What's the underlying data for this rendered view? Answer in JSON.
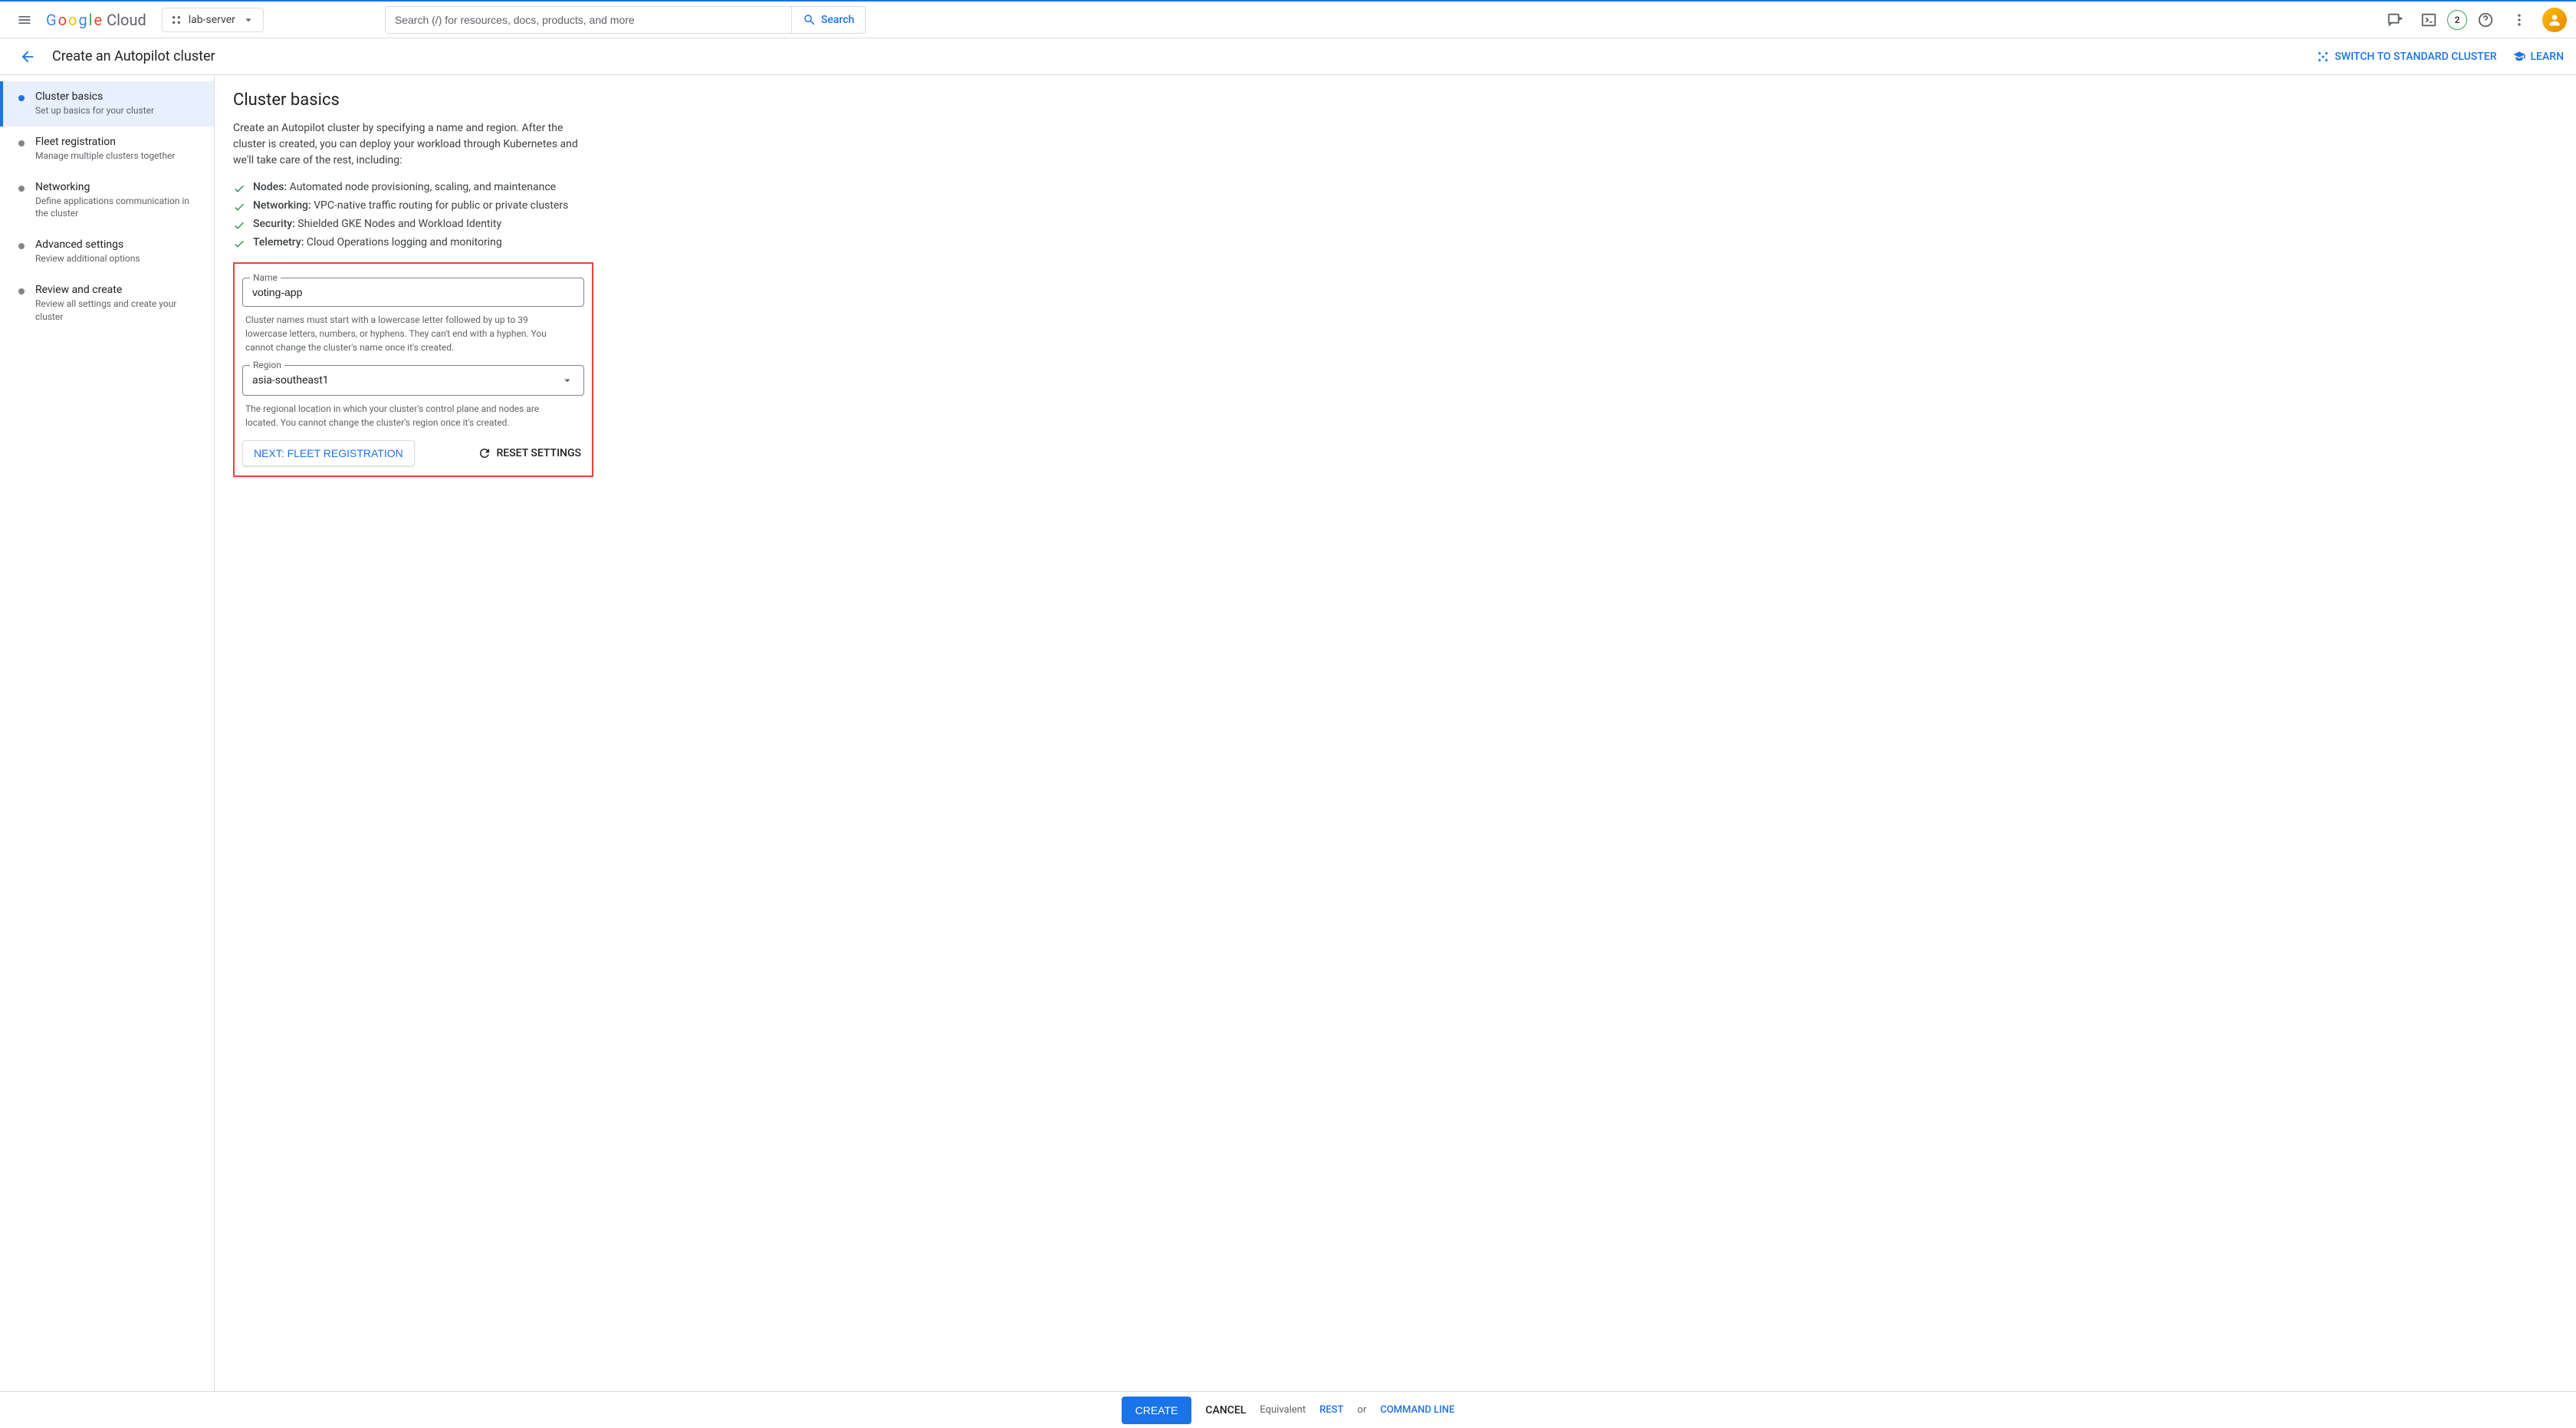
{
  "header": {
    "logo_text": "Google Cloud",
    "project_name": "lab-server",
    "search_placeholder": "Search (/) for resources, docs, products, and more",
    "search_btn": "Search",
    "badge_count": "2"
  },
  "sub_header": {
    "title": "Create an Autopilot cluster",
    "switch_link": "SWITCH TO STANDARD CLUSTER",
    "learn_link": "LEARN"
  },
  "sidebar": {
    "steps": [
      {
        "title": "Cluster basics",
        "desc": "Set up basics for your cluster"
      },
      {
        "title": "Fleet registration",
        "desc": "Manage multiple clusters together"
      },
      {
        "title": "Networking",
        "desc": "Define applications communication in the cluster"
      },
      {
        "title": "Advanced settings",
        "desc": "Review additional options"
      },
      {
        "title": "Review and create",
        "desc": "Review all settings and create your cluster"
      }
    ]
  },
  "content": {
    "heading": "Cluster basics",
    "intro": "Create an Autopilot cluster by specifying a name and region. After the cluster is created, you can deploy your workload through Kubernetes and we'll take care of the rest, including:",
    "features": [
      {
        "bold": "Nodes:",
        "text": " Automated node provisioning, scaling, and maintenance"
      },
      {
        "bold": "Networking:",
        "text": " VPC-native traffic routing for public or private clusters"
      },
      {
        "bold": "Security:",
        "text": " Shielded GKE Nodes and Workload Identity"
      },
      {
        "bold": "Telemetry:",
        "text": " Cloud Operations logging and monitoring"
      }
    ],
    "name_label": "Name",
    "name_value": "voting-app",
    "name_help": "Cluster names must start with a lowercase letter followed by up to 39 lowercase letters, numbers, or hyphens. They can't end with a hyphen. You cannot change the cluster's name once it's created.",
    "region_label": "Region",
    "region_value": "asia-southeast1",
    "region_help": "The regional location in which your cluster's control plane and nodes are located. You cannot change the cluster's region once it's created.",
    "next_btn": "NEXT: FLEET REGISTRATION",
    "reset_btn": "RESET SETTINGS"
  },
  "footer": {
    "create": "CREATE",
    "cancel": "CANCEL",
    "equivalent": "Equivalent",
    "rest": "REST",
    "or": "or",
    "cmd": "COMMAND LINE"
  }
}
